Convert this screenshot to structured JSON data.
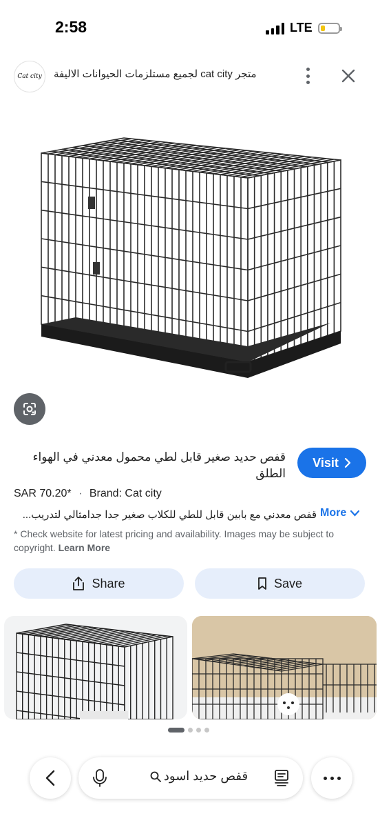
{
  "status": {
    "time": "2:58",
    "network": "LTE",
    "battery_percent": 25,
    "battery_color": "#f2c40f"
  },
  "header": {
    "logo_text": "Cat city",
    "site_title": "متجر cat city لجميع مستلزمات الحيوانات الاليفة",
    "menu_icon": "kebab-menu-icon",
    "close_icon": "close-icon"
  },
  "product": {
    "title": "قفص حديد صغير قابل لطي محمول معدني في الهواء الطلق",
    "visit_label": "Visit",
    "price": "SAR 70.20*",
    "separator": "·",
    "brand": "Brand: Cat city",
    "description": "قفص معدني مع بابين قابل للطي للكلاب صغير جدا جدامثالي لتدريب...",
    "more_label": "More",
    "disclaimer": "* Check website for latest pricing and availability. Images may be subject to copyright.",
    "learn_more": "Learn More"
  },
  "actions": {
    "share_label": "Share",
    "save_label": "Save"
  },
  "carousel": {
    "active_index": 0,
    "dot_count": 4
  },
  "bottom_bar": {
    "query": "قفص حديد اسود",
    "mic_icon": "microphone-icon",
    "lens_icon": "google-lens-icon",
    "back_icon": "chevron-left-icon",
    "more_icon": "more-horizontal-icon"
  },
  "colors": {
    "accent": "#1a73e8",
    "pill_bg": "#e6eefb",
    "lens_button": "#5f6368"
  }
}
